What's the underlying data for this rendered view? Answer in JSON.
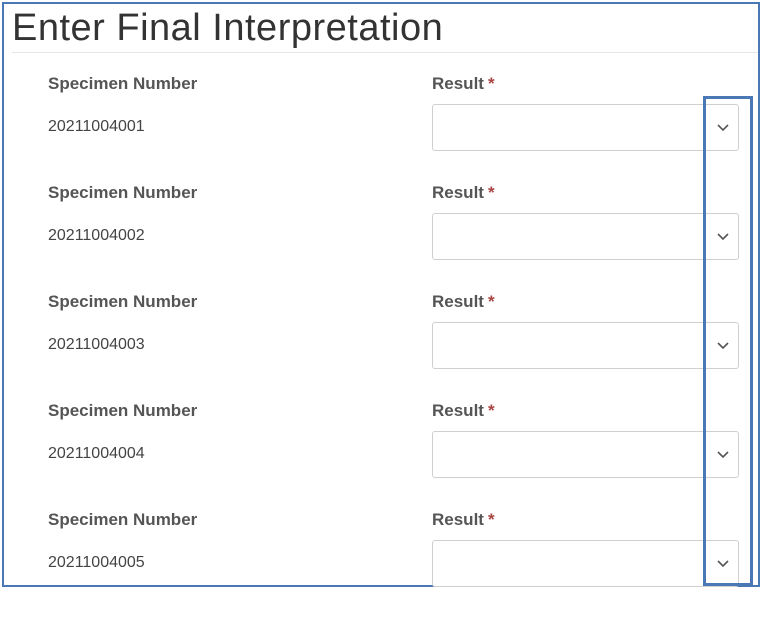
{
  "page": {
    "title": "Enter Final Interpretation"
  },
  "labels": {
    "specimen": "Specimen Number",
    "result": "Result",
    "required_mark": "*"
  },
  "rows": [
    {
      "specimen_number": "20211004001",
      "result_value": ""
    },
    {
      "specimen_number": "20211004002",
      "result_value": ""
    },
    {
      "specimen_number": "20211004003",
      "result_value": ""
    },
    {
      "specimen_number": "20211004004",
      "result_value": ""
    },
    {
      "specimen_number": "20211004005",
      "result_value": ""
    }
  ],
  "colors": {
    "accent_frame": "#4a78b5",
    "required": "#a94442",
    "label": "#555555"
  },
  "icons": {
    "dropdown": "chevron-down-icon"
  }
}
